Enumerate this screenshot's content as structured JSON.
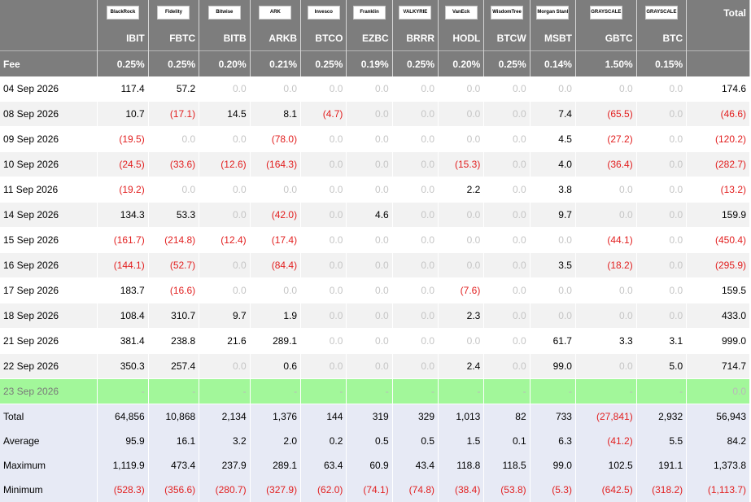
{
  "header": {
    "total_label": "Total",
    "fee_label": "Fee",
    "funds": [
      {
        "issuer": "BlackRock",
        "ticker": "IBIT",
        "fee": "0.25%"
      },
      {
        "issuer": "Fidelity",
        "ticker": "FBTC",
        "fee": "0.25%"
      },
      {
        "issuer": "Bitwise",
        "ticker": "BITB",
        "fee": "0.20%"
      },
      {
        "issuer": "ARK",
        "ticker": "ARKB",
        "fee": "0.21%"
      },
      {
        "issuer": "Invesco",
        "ticker": "BTCO",
        "fee": "0.25%"
      },
      {
        "issuer": "Franklin",
        "ticker": "EZBC",
        "fee": "0.19%"
      },
      {
        "issuer": "VALKYRIE",
        "ticker": "BRRR",
        "fee": "0.25%"
      },
      {
        "issuer": "VanEck",
        "ticker": "HODL",
        "fee": "0.20%"
      },
      {
        "issuer": "WisdomTree",
        "ticker": "BTCW",
        "fee": "0.25%"
      },
      {
        "issuer": "Morgan Stanley",
        "ticker": "MSBT",
        "fee": "0.14%"
      },
      {
        "issuer": "GRAYSCALE",
        "ticker": "GBTC",
        "fee": "1.50%"
      },
      {
        "issuer": "GRAYSCALE",
        "ticker": "BTC",
        "fee": "0.15%"
      }
    ]
  },
  "rows": [
    {
      "date": "04 Sep 2026",
      "values": [
        "117.4",
        "57.2",
        "0.0",
        "0.0",
        "0.0",
        "0.0",
        "0.0",
        "0.0",
        "0.0",
        "0.0",
        "0.0",
        "0.0"
      ],
      "total": "174.6"
    },
    {
      "date": "08 Sep 2026",
      "values": [
        "10.7",
        "(17.1)",
        "14.5",
        "8.1",
        "(4.7)",
        "0.0",
        "0.0",
        "0.0",
        "0.0",
        "7.4",
        "(65.5)",
        "0.0"
      ],
      "total": "(46.6)"
    },
    {
      "date": "09 Sep 2026",
      "values": [
        "(19.5)",
        "0.0",
        "0.0",
        "(78.0)",
        "0.0",
        "0.0",
        "0.0",
        "0.0",
        "0.0",
        "4.5",
        "(27.2)",
        "0.0"
      ],
      "total": "(120.2)"
    },
    {
      "date": "10 Sep 2026",
      "values": [
        "(24.5)",
        "(33.6)",
        "(12.6)",
        "(164.3)",
        "0.0",
        "0.0",
        "0.0",
        "(15.3)",
        "0.0",
        "4.0",
        "(36.4)",
        "0.0"
      ],
      "total": "(282.7)"
    },
    {
      "date": "11 Sep 2026",
      "values": [
        "(19.2)",
        "0.0",
        "0.0",
        "0.0",
        "0.0",
        "0.0",
        "0.0",
        "2.2",
        "0.0",
        "3.8",
        "0.0",
        "0.0"
      ],
      "total": "(13.2)"
    },
    {
      "date": "14 Sep 2026",
      "values": [
        "134.3",
        "53.3",
        "0.0",
        "(42.0)",
        "0.0",
        "4.6",
        "0.0",
        "0.0",
        "0.0",
        "9.7",
        "0.0",
        "0.0"
      ],
      "total": "159.9"
    },
    {
      "date": "15 Sep 2026",
      "values": [
        "(161.7)",
        "(214.8)",
        "(12.4)",
        "(17.4)",
        "0.0",
        "0.0",
        "0.0",
        "0.0",
        "0.0",
        "0.0",
        "(44.1)",
        "0.0"
      ],
      "total": "(450.4)"
    },
    {
      "date": "16 Sep 2026",
      "values": [
        "(144.1)",
        "(52.7)",
        "0.0",
        "(84.4)",
        "0.0",
        "0.0",
        "0.0",
        "0.0",
        "0.0",
        "3.5",
        "(18.2)",
        "0.0"
      ],
      "total": "(295.9)"
    },
    {
      "date": "17 Sep 2026",
      "values": [
        "183.7",
        "(16.6)",
        "0.0",
        "0.0",
        "0.0",
        "0.0",
        "0.0",
        "(7.6)",
        "0.0",
        "0.0",
        "0.0",
        "0.0"
      ],
      "total": "159.5"
    },
    {
      "date": "18 Sep 2026",
      "values": [
        "108.4",
        "310.7",
        "9.7",
        "1.9",
        "0.0",
        "0.0",
        "0.0",
        "2.3",
        "0.0",
        "0.0",
        "0.0",
        "0.0"
      ],
      "total": "433.0"
    },
    {
      "date": "21 Sep 2026",
      "values": [
        "381.4",
        "238.8",
        "21.6",
        "289.1",
        "0.0",
        "0.0",
        "0.0",
        "0.0",
        "0.0",
        "61.7",
        "3.3",
        "3.1"
      ],
      "total": "999.0"
    },
    {
      "date": "22 Sep 2026",
      "values": [
        "350.3",
        "257.4",
        "0.0",
        "0.6",
        "0.0",
        "0.0",
        "0.0",
        "2.4",
        "0.0",
        "99.0",
        "0.0",
        "5.0"
      ],
      "total": "714.7"
    }
  ],
  "today": {
    "date": "23 Sep 2026",
    "values": [
      "-",
      "-",
      "-",
      "-",
      "-",
      "-",
      "-",
      "-",
      "-",
      "-",
      "-",
      "-"
    ],
    "total": "0.0"
  },
  "summary": [
    {
      "label": "Total",
      "values": [
        "64,856",
        "10,868",
        "2,134",
        "1,376",
        "144",
        "319",
        "329",
        "1,013",
        "82",
        "733",
        "(27,841)",
        "2,932"
      ],
      "total": "56,943"
    },
    {
      "label": "Average",
      "values": [
        "95.9",
        "16.1",
        "3.2",
        "2.0",
        "0.2",
        "0.5",
        "0.5",
        "1.5",
        "0.1",
        "6.3",
        "(41.2)",
        "5.5"
      ],
      "total": "84.2"
    },
    {
      "label": "Maximum",
      "values": [
        "1,119.9",
        "473.4",
        "237.9",
        "289.1",
        "63.4",
        "60.9",
        "43.4",
        "118.8",
        "118.5",
        "99.0",
        "102.5",
        "191.1"
      ],
      "total": "1,373.8"
    },
    {
      "label": "Minimum",
      "values": [
        "(528.3)",
        "(356.6)",
        "(280.7)",
        "(327.9)",
        "(62.0)",
        "(74.1)",
        "(74.8)",
        "(38.4)",
        "(53.8)",
        "(5.3)",
        "(642.5)",
        "(318.2)"
      ],
      "total": "(1,113.7)"
    }
  ]
}
